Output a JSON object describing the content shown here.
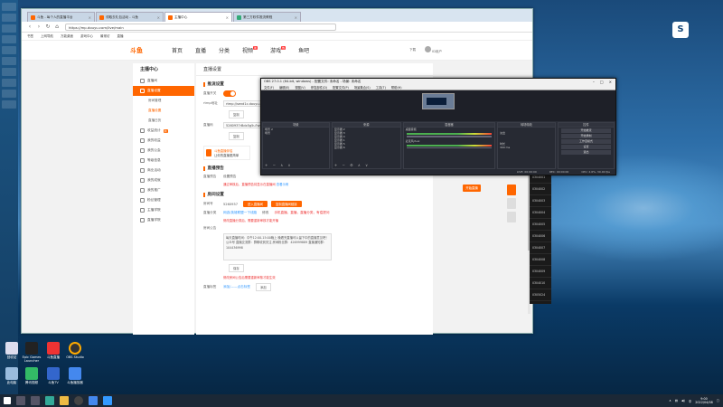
{
  "browser": {
    "tabs": [
      {
        "label": "斗鱼 - 每个人的直播平台"
      },
      {
        "label": "领取去礼包活动 - 斗鱼"
      },
      {
        "label": "主播中心"
      },
      {
        "label": "第三方软件推流教程"
      }
    ],
    "url": "https://mp.douyu.com/live/main",
    "bookmarks": [
      "书签",
      "上网导航",
      "万能桌面",
      "游戏中心",
      "最常访",
      "直播"
    ]
  },
  "site": {
    "logo": "斗鱼",
    "nav": [
      "首页",
      "直播",
      "分类",
      "视频",
      "游戏",
      "鱼吧"
    ],
    "nav_badges": {
      "video": "新",
      "game": "热"
    },
    "header_right": {
      "download": "下载",
      "user": "ID用户"
    }
  },
  "sidebar": {
    "title": "主播中心",
    "items": [
      {
        "label": "直播间"
      },
      {
        "label": "直播设置",
        "active": true
      },
      {
        "label": "房间管理",
        "sub": true
      },
      {
        "label": "直播设置",
        "sub": true,
        "current": true
      },
      {
        "label": "直播日历",
        "sub": true
      },
      {
        "label": "收益统计",
        "badge": "新"
      },
      {
        "label": "我的收益"
      },
      {
        "label": "我的公会"
      },
      {
        "label": "等级信息"
      },
      {
        "label": "商业活动"
      },
      {
        "label": "我的成就"
      },
      {
        "label": "我的推广"
      },
      {
        "label": "粉丝管理"
      },
      {
        "label": "主播学院"
      },
      {
        "label": "直播学院"
      }
    ]
  },
  "panel": {
    "title": "直播设置",
    "push_section": "推流设置",
    "push_toggle_label": "直播开关",
    "rtmp_label": "rtmp地址",
    "rtmp_value": "rtmp://send1c.douyu.com/live",
    "copy_label": "复制",
    "stream_code_label": "直播码",
    "stream_code_value": "5260937rBdx5g5u?wsSecret=...",
    "copy_label2": "复制",
    "promo_title": "斗鱼直播伴侣",
    "promo_sub": "让你的直播更简单",
    "preview_section": "直播预告",
    "preview_label": "直播预告",
    "preview_value": "设置预告",
    "preview_warn": "通过审核后，直播预告将显示在直播间",
    "preview_link": "查看示例",
    "room_section": "房间设置",
    "room_id_label": "房间号",
    "room_id_value": "5260937",
    "btn_enter": "进入直播间",
    "btn_copy": "复制直播间链接",
    "category_label": "直播分类",
    "category_link": "网游/英雄联盟一下线路",
    "category_sub": "修改",
    "category_tags": "手机直播，直播，直播分类，有偿提问",
    "category_warn": "修改直播分类后，需要重新审核才能开播",
    "notice_label": "房间公告",
    "notice_text": "每天直播时间：中午12:00-15:00晚上 晚看完直播可以留下中的直播意见吧！ 公众号 直播交流群：群聊收到关注 房间粉丝群：426999889 直播通知群：104436998",
    "notice_btn": "保存",
    "notice_warn": "修改房间公告后需要重新审核才能生效",
    "tag_label": "直播标签",
    "tag_link": "添加/——点击标签",
    "tag_btn": "添加"
  },
  "float_buttons": {
    "start": "开始直播"
  },
  "obs": {
    "title": "OBS 27.0.1 (64-bit, windows) - 配置文件: 未命名 - 场景: 未命名",
    "menu": [
      "文件(F)",
      "编辑(E)",
      "视图(V)",
      "停靠部件(D)",
      "配置文件(P)",
      "场景集合(S)",
      "工具(T)",
      "帮助(H)"
    ],
    "docks": {
      "scenes": {
        "title": "场景",
        "items": [
          "场景 2",
          "场景"
        ]
      },
      "sources": {
        "title": "来源",
        "items": [
          "显示器 2",
          "显示器 3",
          "显示器 4",
          "显示器 1",
          "显示器 5",
          "显示器 6"
        ]
      },
      "mixer": {
        "title": "混音器",
        "channels": [
          "桌面音频",
          "麦克风/Aux"
        ]
      },
      "transitions": {
        "title": "转场特效",
        "type": "淡出",
        "duration_label": "时长",
        "duration": "300 ms"
      },
      "controls": {
        "title": "控件",
        "buttons": [
          "开始推流",
          "开始录制",
          "工作室模式",
          "设置",
          "退出"
        ]
      }
    },
    "status": {
      "live": "LIVE: 00:00:00",
      "rec": "REC: 00:00:00",
      "cpu": "CPU: 2.6%, 30.00 fps"
    }
  },
  "obs_list": [
    "0304001",
    "0304002",
    "0304003",
    "0304004",
    "0304005",
    "0304006",
    "0304007",
    "0304008",
    "0304009",
    "0304010",
    "0305024"
  ],
  "desktop_icons": [
    {
      "label": "回收站"
    },
    {
      "label": "Epic Games Launcher"
    },
    {
      "label": "斗鱼直播"
    },
    {
      "label": "OBS Studio"
    },
    {
      "label": "此电脑"
    },
    {
      "label": "腾讯视频"
    },
    {
      "label": "斗鱼TV"
    },
    {
      "label": "斗鱼播放器"
    }
  ],
  "taskbar": {
    "time": "9:00",
    "date": "2022/04/08",
    "ime": "中"
  }
}
